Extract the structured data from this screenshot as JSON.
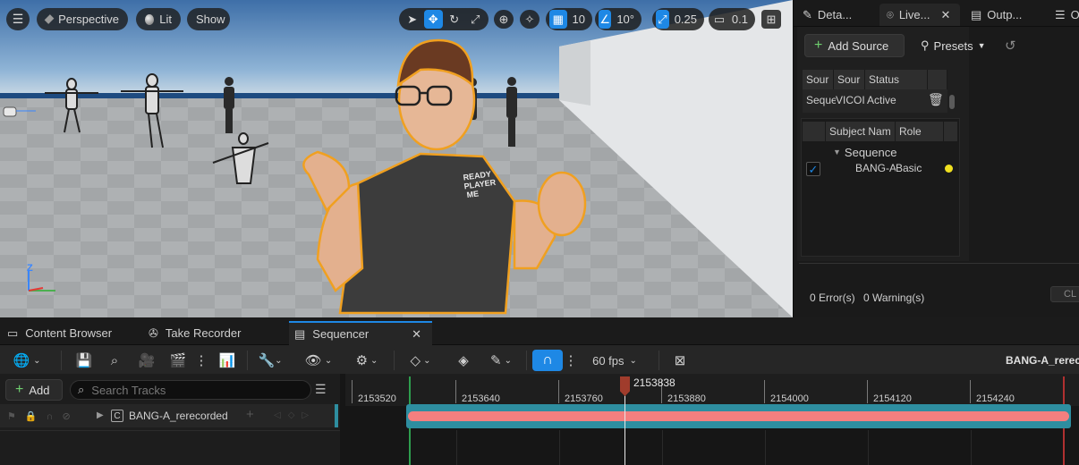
{
  "viewport": {
    "menu_icon": "hamburger-icon",
    "perspective_label": "Perspective",
    "lit_label": "Lit",
    "show_label": "Show",
    "grid_snap_value": "10",
    "rotation_snap_value": "10°",
    "scale_snap_value": "0.25",
    "camera_speed_value": "0.1",
    "axis_labels": {
      "z": "Z"
    }
  },
  "right_panel": {
    "tabs": [
      {
        "label": "Deta...",
        "icon": "pencil-icon"
      },
      {
        "label": "Live...",
        "icon": "live-link-icon"
      },
      {
        "label": "Outp...",
        "icon": "output-log-icon"
      },
      {
        "label": "O",
        "icon": "list-icon"
      }
    ],
    "add_source_label": "Add Source",
    "presets_label": "Presets",
    "sources_table": {
      "headers": [
        "Sour",
        "Sour",
        "Status"
      ],
      "rows": [
        {
          "source": "Seque",
          "type": "VICOI",
          "status": "Active"
        }
      ]
    },
    "subjects_table": {
      "headers": [
        "Subject Nam",
        "Role"
      ],
      "group": "Sequence",
      "rows": [
        {
          "name": "BANG-A",
          "role": "Basic",
          "enabled": true
        }
      ]
    },
    "errors_text": "0 Error(s)",
    "warnings_text": "0 Warning(s)",
    "clear_label": "CL"
  },
  "bottom": {
    "tabs": [
      {
        "label": "Content Browser",
        "icon": "content-browser-icon"
      },
      {
        "label": "Take Recorder",
        "icon": "film-reel-icon"
      },
      {
        "label": "Sequencer",
        "icon": "clapper-icon"
      }
    ],
    "fps_label": "60 fps",
    "sequence_name": "BANG-A_rerecord",
    "add_label": "Add",
    "search_placeholder": "Search Tracks",
    "track_name": "BANG-A_rerecorded",
    "playhead_frame": "2153838",
    "timeline_ticks": [
      "2153520",
      "2153640",
      "2153760",
      "2153880",
      "2154000",
      "2154120",
      "2154240"
    ]
  },
  "colors": {
    "accent": "#1e88e5",
    "selection_outline": "#f0a020",
    "section_bar": "#f47f7f",
    "section_border": "#2e8ea0",
    "status_dot": "#f0e020",
    "playhead": "#a03c2c"
  }
}
